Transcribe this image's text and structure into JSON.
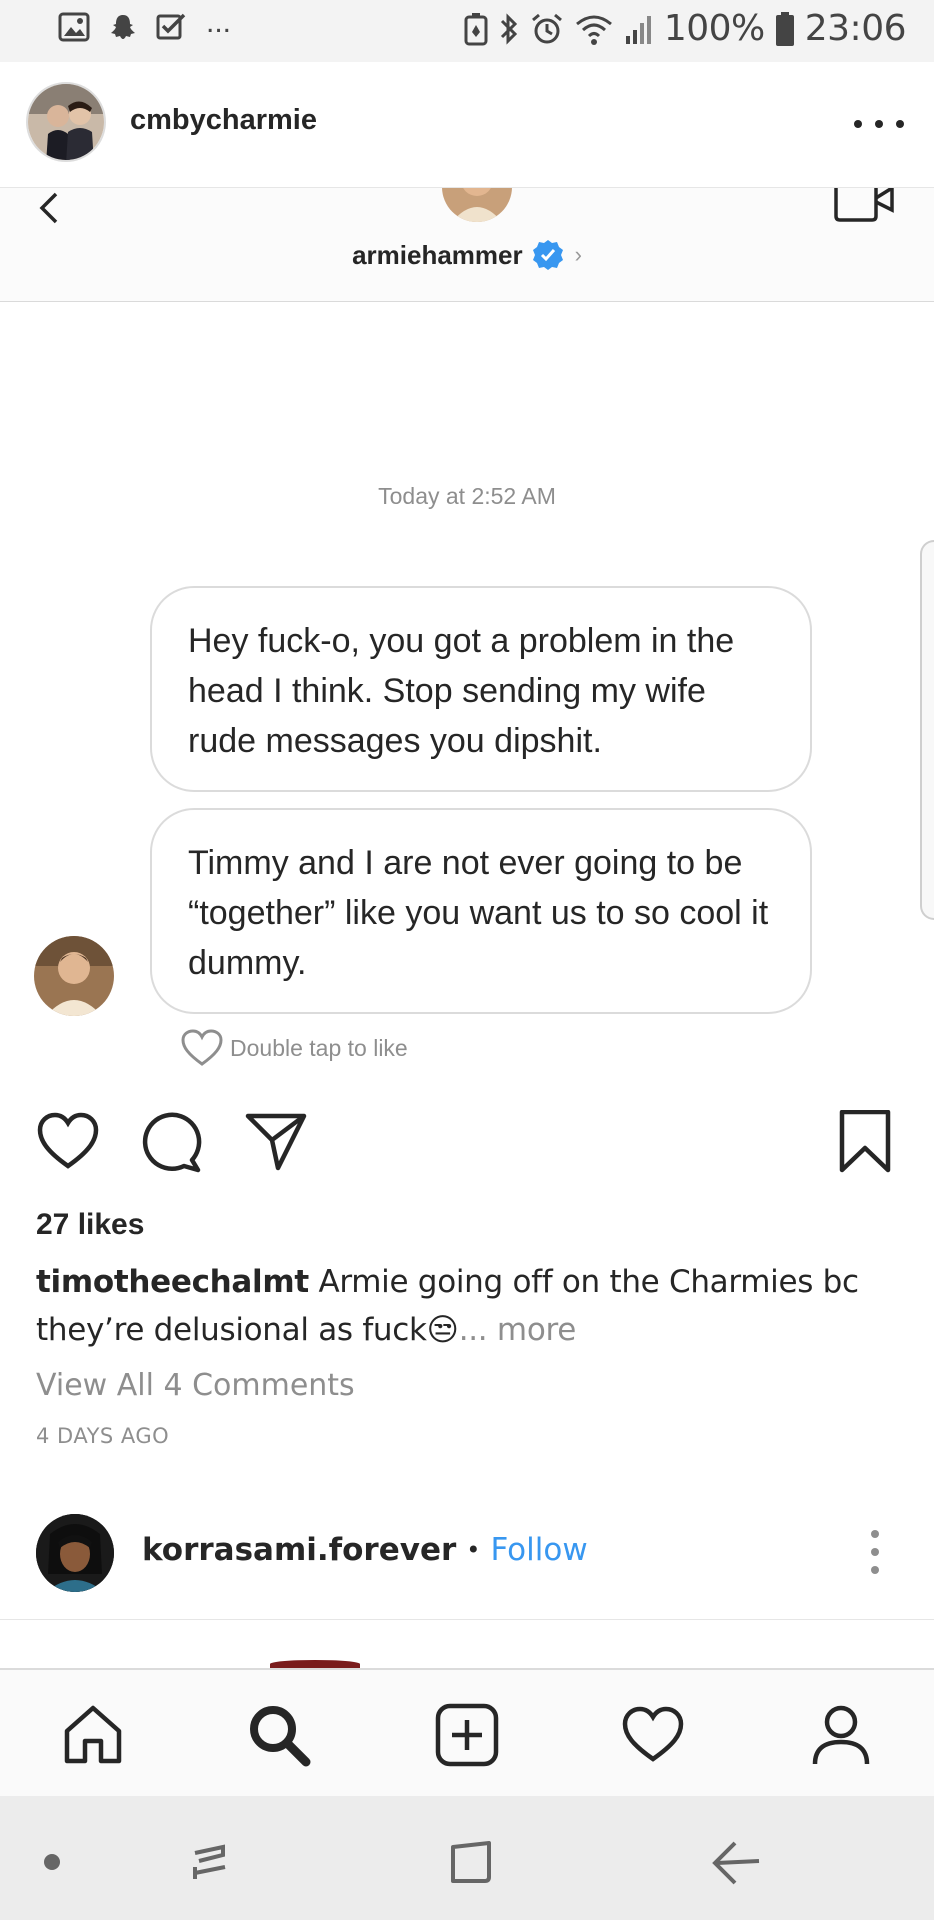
{
  "status_bar": {
    "left_icons": [
      "gallery-icon",
      "snapchat-icon",
      "checkbox-icon"
    ],
    "overflow": "...",
    "right_icons": [
      "battery-saver-icon",
      "bluetooth-icon",
      "alarm-icon",
      "wifi-icon",
      "signal-icon"
    ],
    "battery_percent": "100%",
    "time": "23:06"
  },
  "post": {
    "username": "cmbycharmie",
    "avatar_icon": "profile-avatar"
  },
  "dm": {
    "contact_name": "armiehammer",
    "verified_icon": "verified-badge-icon",
    "timestamp": "Today at 2:52 AM",
    "messages": [
      "Hey fuck-o, you got a problem in the head I think. Stop sending my wife rude messages you dipshit.",
      "Timmy and I are not ever going to be “together” like you want us to so cool it dummy."
    ],
    "double_tap_label": "Double tap to like"
  },
  "engagement": {
    "likes": "27 likes",
    "caption_user": "timotheechalmt",
    "caption_text": "Armie going off on the Charmies bc they’re delusional as fuck😒",
    "caption_more": "... more",
    "view_comments": "View All 4 Comments",
    "posted": "4 DAYS AGO"
  },
  "next_post": {
    "username": "korrasami.forever",
    "separator": "•",
    "follow_label": "Follow"
  },
  "bottom_nav": [
    "home-icon",
    "search-icon",
    "add-post-icon",
    "activity-heart-icon",
    "profile-icon"
  ],
  "colors": {
    "link_blue": "#3897f0",
    "text_primary": "#262626",
    "text_secondary": "#8e8e8e",
    "verified_blue": "#3897f0"
  }
}
